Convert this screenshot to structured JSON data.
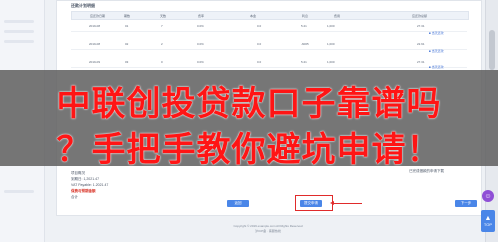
{
  "section_title": "还款计划明细",
  "table": {
    "headers": [
      "应还款日期",
      "期数",
      "天数",
      "费率",
      "本金",
      "利息",
      "费用",
      "应还款总额"
    ],
    "rows": [
      {
        "date": "2019-08",
        "period": "01",
        "days": "7",
        "rate": "0.0%",
        "p": "0.0",
        "i": "5.21",
        "fee": "1,000",
        "total": "27.31"
      },
      {
        "date": "2019-08",
        "period": "02",
        "days": "2",
        "rate": "0.0%",
        "p": "0.0",
        "i": "-6005",
        "fee": "1,000",
        "total": "22.91"
      },
      {
        "date": "2019-09",
        "period": "03",
        "days": "0",
        "rate": "0.0%",
        "p": "0.0",
        "i": "5.21",
        "fee": "1,000",
        "total": "27.31"
      }
    ],
    "tags": [
      "当天还款",
      "当天还款",
      "当天还款"
    ]
  },
  "side_note": "已完成借款的申请下载",
  "misc_lines": [
    "项目概况",
    "到期日: 1,2021.47",
    "VAT Payable: 1.2021.47",
    "合计"
  ],
  "red_line": "保费与预期金额",
  "buttons": {
    "back": "返回",
    "submit": "提交申请",
    "next": "下一步"
  },
  "footer": {
    "line1": "Copyright © 2019 example.com All Rights Reserved",
    "line2": "沪ICP备 · 客服热线"
  },
  "banner": {
    "line1": "中联创投贷款口子靠谱吗",
    "line2": "？手把手教你避坑申请！"
  },
  "top_button": "TOP",
  "colors": {
    "accent": "#4a86e8",
    "banner_text": "#ff1515",
    "highlight": "#e02b2b"
  }
}
